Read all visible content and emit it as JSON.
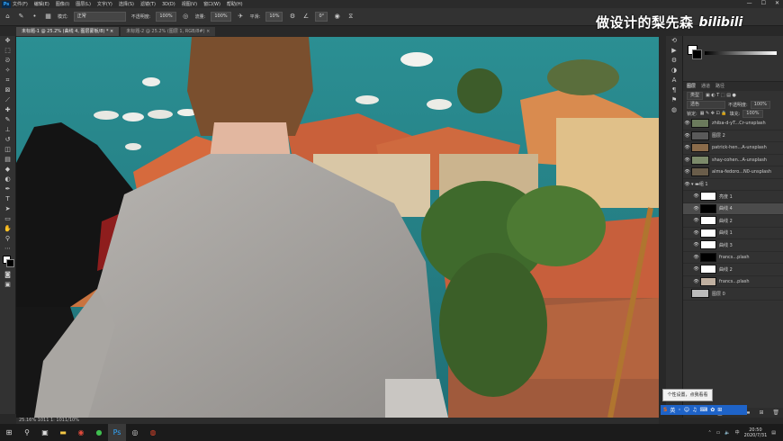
{
  "app": {
    "logo": "Ps",
    "menu": [
      "文件(F)",
      "编辑(E)",
      "图像(I)",
      "图层(L)",
      "文字(Y)",
      "选择(S)",
      "滤镜(T)",
      "3D(D)",
      "视图(V)",
      "窗口(W)",
      "帮助(H)"
    ],
    "window_controls": [
      "—",
      "☐",
      "✕"
    ]
  },
  "options_bar": {
    "mode_label": "模式:",
    "mode_value": "正常",
    "opacity_label": "不透明度:",
    "opacity_value": "100%",
    "flow_label": "流量:",
    "flow_value": "100%",
    "smooth_label": "平滑:",
    "smooth_value": "10%",
    "angle_value": "0°"
  },
  "doc_tabs": [
    {
      "label": "未标题-1 @ 25.2% (曲线 4, 图层蒙板/8) *",
      "close": "×"
    },
    {
      "label": "未标题-2 @ 25.2% (图层 1, RGB/8#)",
      "close": "×"
    }
  ],
  "status": {
    "text": "25.16%  1011 1:  1011/10%"
  },
  "watermark": {
    "text": "做设计的梨先森",
    "brand": "bilibili"
  },
  "colors": {
    "accent": "#31a8ff",
    "ime": "#1e63c8"
  },
  "layers_panel": {
    "tabs": [
      "图层",
      "通道",
      "路径"
    ],
    "filter_label": "类型",
    "blend_mode": "透色",
    "opacity_label": "不透明度:",
    "opacity_value": "100%",
    "lock_label": "锁定:",
    "fill_label": "填充:",
    "fill_value": "100%",
    "layers": [
      {
        "name": "zhiba-d-yT...Cr-unsplash"
      },
      {
        "name": "图层 2"
      },
      {
        "name": "patrick-hen...A-unsplash"
      },
      {
        "name": "shay-cohen...A-unsplash"
      },
      {
        "name": "alma-fedoro...N0-unsplash"
      },
      {
        "name": "组 1"
      },
      {
        "name": "亮度 1"
      },
      {
        "name": "曲线 4"
      },
      {
        "name": "曲线 2"
      },
      {
        "name": "曲线 1"
      },
      {
        "name": "曲线 3"
      },
      {
        "name": "francs...plash"
      },
      {
        "name": "曲线 2"
      },
      {
        "name": "francs...plash"
      },
      {
        "name": "图层 0"
      }
    ]
  },
  "tooltip": {
    "text": "个性设置，点我看看"
  },
  "ime_bar": {
    "label": "英"
  },
  "taskbar": {
    "time": "20:50",
    "date": "2020/7/31"
  }
}
